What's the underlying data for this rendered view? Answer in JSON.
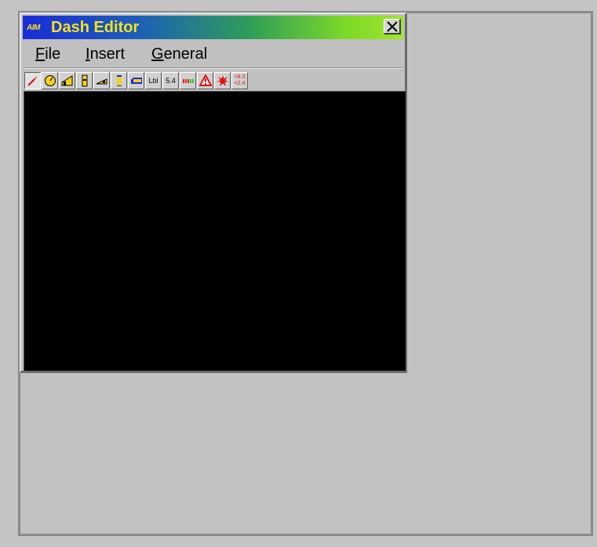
{
  "window": {
    "logo_text": "AIM",
    "title": "Dash Editor",
    "title_color": "#f4e21a"
  },
  "menu": {
    "file": {
      "hotkey": "F",
      "rest": "ile"
    },
    "insert": {
      "hotkey": "I",
      "rest": "nsert"
    },
    "general": {
      "hotkey": "G",
      "rest": "eneral"
    }
  },
  "toolbar": {
    "tools": [
      {
        "name": "pointer-tool",
        "icon": "red-arrow-icon"
      },
      {
        "name": "gauge-tool",
        "icon": "round-gauge-icon"
      },
      {
        "name": "bar-area-tool",
        "icon": "bar-graph-icon"
      },
      {
        "name": "vertical-bar-tool",
        "icon": "vertical-bar-icon"
      },
      {
        "name": "horizontal-bar-tool",
        "icon": "horizontal-bar-icon"
      },
      {
        "name": "vertical-bar-2-tool",
        "icon": "vertical-bar-filled-icon"
      },
      {
        "name": "horizontal-bar-2-tool",
        "icon": "horizontal-bar-filled-icon"
      },
      {
        "name": "label-tool",
        "label": "Lbl"
      },
      {
        "name": "value-tool",
        "label": "5.4"
      },
      {
        "name": "shift-lights-tool",
        "icon": "shift-lights-icon"
      },
      {
        "name": "warning-tool",
        "icon": "warning-triangle-icon"
      },
      {
        "name": "alarm-tool",
        "icon": "red-burst-icon"
      },
      {
        "name": "threshold-tool",
        "line1": ">9.3",
        "line2": "<2.4"
      }
    ],
    "label_lbl": "Lbl",
    "label_value": "5.4",
    "threshold_line1": ">9.3",
    "threshold_line2": "<2.4"
  },
  "colors": {
    "canvas": "#000000",
    "background": "#c4c4c4"
  }
}
